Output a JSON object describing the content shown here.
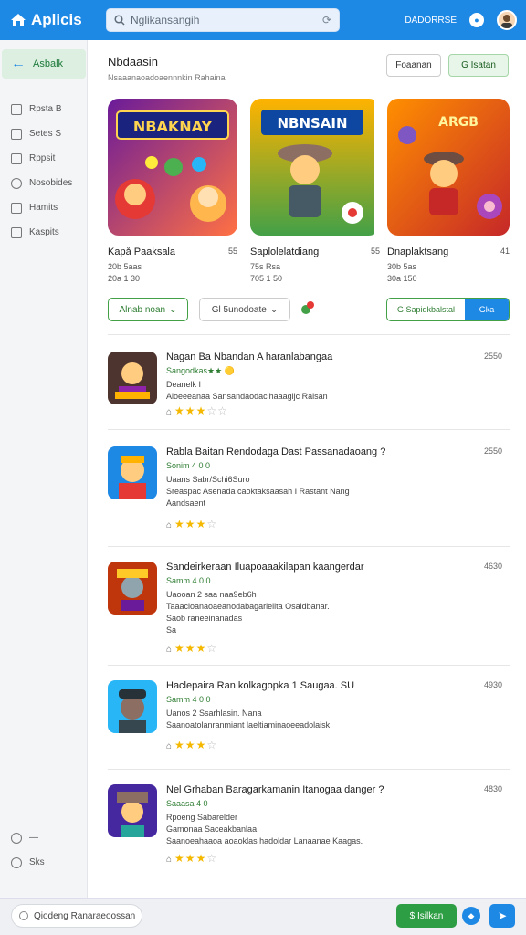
{
  "app": {
    "brand": "Aplicis"
  },
  "search": {
    "placeholder": "Nglikansangih"
  },
  "topbar": {
    "right_label": "DADORRSE"
  },
  "sidebar": {
    "back_label": "Asbalk",
    "items": [
      {
        "label": "Rpsta B",
        "icon": "grid-icon"
      },
      {
        "label": "Setes S",
        "icon": "calendar-icon"
      },
      {
        "label": "Rppsit",
        "icon": "person-icon"
      },
      {
        "label": "Nosobides",
        "icon": "chat-icon"
      },
      {
        "label": "Hamits",
        "icon": "folder-icon"
      },
      {
        "label": "Kaspits",
        "icon": "image-icon"
      }
    ],
    "bottom_items": [
      {
        "label": "—",
        "icon": "settings-icon"
      },
      {
        "label": "Sks",
        "icon": "help-icon"
      }
    ]
  },
  "header": {
    "title": "Nbdaasin",
    "subtitle": "Nsaaanaoadoaennnkin Rahaina",
    "btn_secondary": "Foaanan",
    "btn_primary": "G Isatan"
  },
  "featured": [
    {
      "title": "Kapå Paaksala",
      "num": "55",
      "meta1": "20b 5aas",
      "meta2": "20a 1 30",
      "art_text": "NBAKNAY"
    },
    {
      "title": "Saplolelatdiang",
      "num": "55",
      "meta1": "75s Rsa",
      "meta2": "705 1 50",
      "art_text": "NBNSAIN"
    },
    {
      "title": "Dnaplaktsang",
      "num": "41",
      "meta1": "30b 5as",
      "meta2": "30a 150",
      "art_text": "ARGB"
    }
  ],
  "filters": {
    "f1": "Alnab noan",
    "f2": "Gl 5unodoate",
    "seg_a": "G Sapidkbalstal",
    "seg_b": "Gka"
  },
  "list": [
    {
      "title": "Nagan Ba Nbandan A haranlabangaa",
      "meta": "Sangodkas★★ 🟡",
      "lines": [
        "Deanelk  I",
        "Aloeeeanaa  Sansandaodacihaaagijc Raisan"
      ],
      "stars": 3,
      "count": "2550"
    },
    {
      "title": "Rabla Baitan Rendodaga Dast Passanadaoang ?",
      "meta": "Sonim  4 0 0",
      "lines": [
        "Uaans  Sabr/Schi6Suro",
        "Sreaspac  Asenada caoktaksaasah  I Rastant Nang",
        "Aandsaent"
      ],
      "stars": 3,
      "count": "2550"
    },
    {
      "title": "Sandeirkeraan Iluapoaaakilapan kaangerdar",
      "meta": "Samm  4 0 0",
      "lines": [
        "Uaooan  2 saa naa9eb6h",
        "Taaacioanaoaeanodabagarieiita  Osaldbanar.",
        "Saob  raneeinanadas",
        "Sa"
      ],
      "stars": 3,
      "count": "4630"
    },
    {
      "title": "Haclepaira Ran kolkagopka 1 Saugaa. SU",
      "meta": "Samm  4 0 0",
      "lines": [
        "Uanos  2 Ssarhlasin. Nana",
        "Saanoatolanranmiant laeltiaminaoeeadolaisk"
      ],
      "stars": 3,
      "count": "4930"
    },
    {
      "title": "Nel Grhaban Baragarkamanin Itanogaa danger ?",
      "meta": "Saaasa 4 0",
      "lines": [
        "Rpoeng  Sabarelder",
        "Gamonaa  Saceakbanlaa",
        "Saanoeahaaoa aoaoklas hadoldar Lanaanae Kaagas."
      ],
      "stars": 3,
      "count": "4830"
    }
  ],
  "bottombar": {
    "chat_placeholder": "Qiodeng Ranaraeoossan",
    "green_btn": "$ Isilkan"
  },
  "colors": {
    "accent": "#1e88e5",
    "green": "#2e9e45",
    "star": "#f5b800"
  }
}
